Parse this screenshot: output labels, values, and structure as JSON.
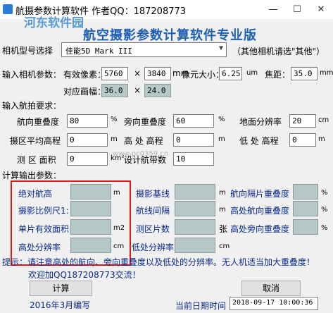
{
  "window": {
    "title": "航摄参数计算软件 作者QQ：187208773",
    "min": "—",
    "max": "☐",
    "close": "✕"
  },
  "heading": "航空摄影参数计算软件专业版",
  "watermarks": {
    "site": "河东软件园",
    "url": "www.pc0359.cn"
  },
  "camera": {
    "label": "相机型号选择",
    "value": "佳能5D Mark III",
    "other_hint": "（其他相机请选\"其他\"）"
  },
  "camera_params": {
    "section": "输入相机参数：",
    "valid_pixels_label": "有效像素：",
    "width": "5760",
    "times": "×",
    "height": "3840",
    "unit_mm": "mm",
    "pixel_size_label": "像元大小：",
    "pixel_size": "6.25",
    "unit_um": "um",
    "focal_label": "焦距：",
    "focal": "35.0",
    "unit_mm2": "mm",
    "format_label": "对应画幅：",
    "format_w": "36.0",
    "format_h": "24.0"
  },
  "requirements": {
    "section": "输入航拍要求：",
    "forward_overlap_label": "航向重叠度",
    "forward_overlap": "80",
    "pct": "%",
    "side_overlap_label": "旁向重叠度",
    "side_overlap": "60",
    "pct2": "%",
    "gsd_label": "地面分辨率",
    "gsd": "20",
    "unit_cm": "cm",
    "avg_elev_label": "摄区平均高程",
    "avg_elev": "0",
    "unit_m": "m",
    "high_elev_label": "高 处 高程",
    "high_elev": "0",
    "unit_m2": "m",
    "low_elev_label": "低 处 高程",
    "low_elev": "0",
    "unit_m3": "m",
    "area_label": "测 区 面积",
    "area": "0",
    "unit_km2": "km²",
    "strips_label": "设计航带数",
    "strips": "10"
  },
  "outputs": {
    "section": "计算输出参数：",
    "abs_height": "绝对航高",
    "unit_m": "m",
    "scale": "摄影比例尺1:",
    "single_area": "单片有效面积",
    "unit_m2": "m2",
    "high_res": "高处分辨率",
    "unit_cm": "cm",
    "baseline": "摄影基线",
    "unit_m_b": "m",
    "strip_spacing": "航线间隔",
    "unit_m_s": "m",
    "photo_count": "测区片数",
    "unit_zhang": "张",
    "low_res": "低处分辨率",
    "unit_cm_l": "cm",
    "fwd_between": "航向隔片重叠度",
    "pct_a": "%",
    "high_fwd": "高处航向重叠度",
    "pct_b": "%",
    "high_side": "高处旁向重叠度",
    "pct_c": "%"
  },
  "tip": {
    "line1": "提示：请注意高处的航向、旁向重叠度以及低处的分辨率。无人机适当加大重叠度！",
    "line2": "欢迎加QQ187208773交流！"
  },
  "buttons": {
    "calc": "计算",
    "cancel": "取消"
  },
  "footer": {
    "compiled": "2016年3月编写",
    "date_label": "当前日期时间",
    "datetime": "2018-09-17 10:00:36"
  }
}
